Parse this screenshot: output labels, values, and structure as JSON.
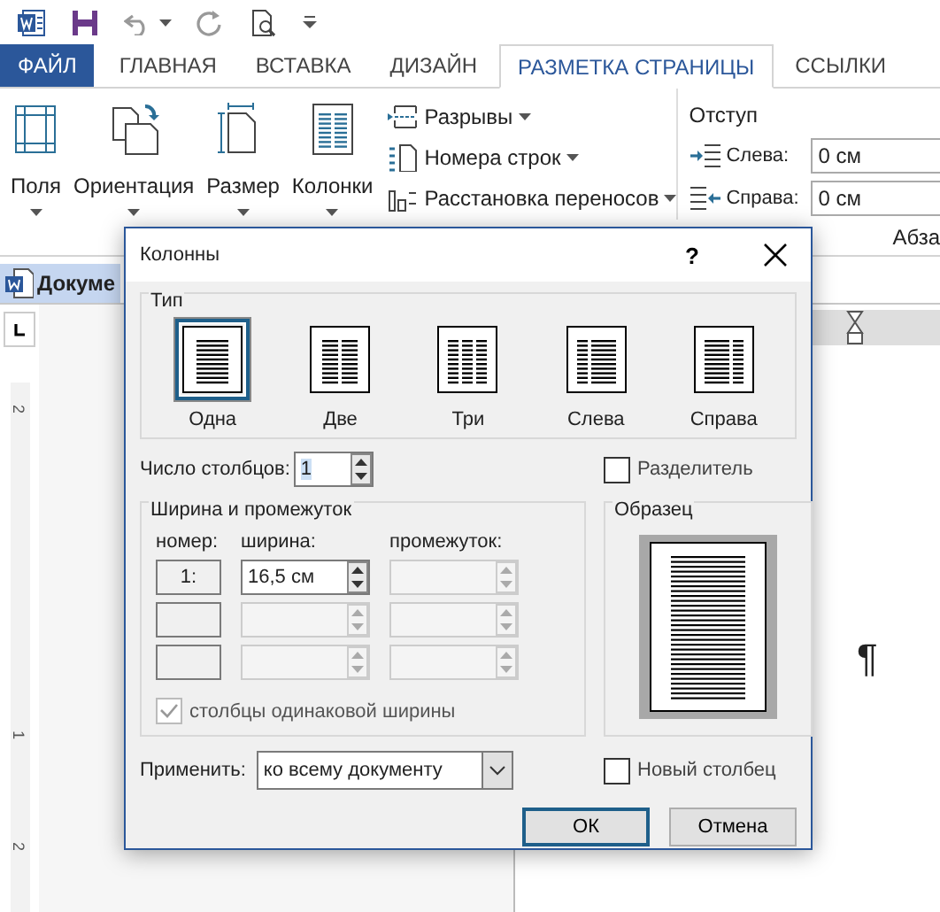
{
  "ribbon_tabs": [
    {
      "label": "ФАЙЛ",
      "kind": "file",
      "selected": false
    },
    {
      "label": "ГЛАВНАЯ",
      "kind": "tab",
      "selected": false
    },
    {
      "label": "ВСТАВКА",
      "kind": "tab",
      "selected": false
    },
    {
      "label": "ДИЗАЙН",
      "kind": "tab",
      "selected": false
    },
    {
      "label": "РАЗМЕТКА СТРАНИЦЫ",
      "kind": "tab",
      "selected": true
    },
    {
      "label": "ССЫЛКИ",
      "kind": "tab",
      "selected": false
    }
  ],
  "ribbon": {
    "large_buttons": [
      {
        "label": "Поля",
        "kind": "margins"
      },
      {
        "label": "Ориентация",
        "kind": "orientation"
      },
      {
        "label": "Размер",
        "kind": "size"
      },
      {
        "label": "Колонки",
        "kind": "columns"
      }
    ],
    "small_buttons": [
      {
        "label": "Разрывы",
        "kind": "breaks"
      },
      {
        "label": "Номера строк",
        "kind": "line_numbers"
      },
      {
        "label": "Расстановка переносов",
        "kind": "hyphenation"
      }
    ],
    "indent": {
      "title": "Отступ",
      "fields": [
        {
          "label": "Слева:",
          "kind": "left",
          "value": "0 см"
        },
        {
          "label": "Справа:",
          "kind": "right",
          "value": "0 см"
        }
      ]
    },
    "group_label": "Абза"
  },
  "document_tab": "Докуме",
  "vertical_ruler": [
    "2",
    "1",
    "2"
  ],
  "paragraph_mark": "¶",
  "dialog": {
    "title": "Колонны",
    "help": "?",
    "type_group": {
      "title": "Тип",
      "presets": [
        {
          "label": "Одна",
          "kind": "one",
          "selected": true
        },
        {
          "label": "Две",
          "kind": "two",
          "selected": false
        },
        {
          "label": "Три",
          "kind": "three",
          "selected": false
        },
        {
          "label": "Слева",
          "kind": "left",
          "selected": false
        },
        {
          "label": "Справа",
          "kind": "right",
          "selected": false
        }
      ]
    },
    "columns_count": {
      "label": "Число столбцов:",
      "value": "1"
    },
    "separator": {
      "label": "Разделитель",
      "checked": false
    },
    "width_group": {
      "title": "Ширина и промежуток",
      "headers": [
        "номер:",
        "ширина:",
        "промежуток:"
      ],
      "rows": [
        {
          "number": "1:",
          "width": "16,5 см",
          "width_disabled": false,
          "spacing_disabled": true
        },
        {
          "width_disabled": true,
          "spacing_disabled": true
        },
        {
          "width_disabled": true,
          "spacing_disabled": true
        }
      ],
      "equal_width": {
        "label": "столбцы одинаковой ширины",
        "checked": true,
        "disabled": true
      }
    },
    "preview": {
      "title": "Образец"
    },
    "apply": {
      "label": "Применить:",
      "value": "ко всему документу"
    },
    "new_column": {
      "label": "Новый столбец",
      "checked": false
    },
    "buttons": [
      {
        "label": "ОК",
        "default": true
      },
      {
        "label": "Отмена",
        "default": false
      }
    ]
  }
}
